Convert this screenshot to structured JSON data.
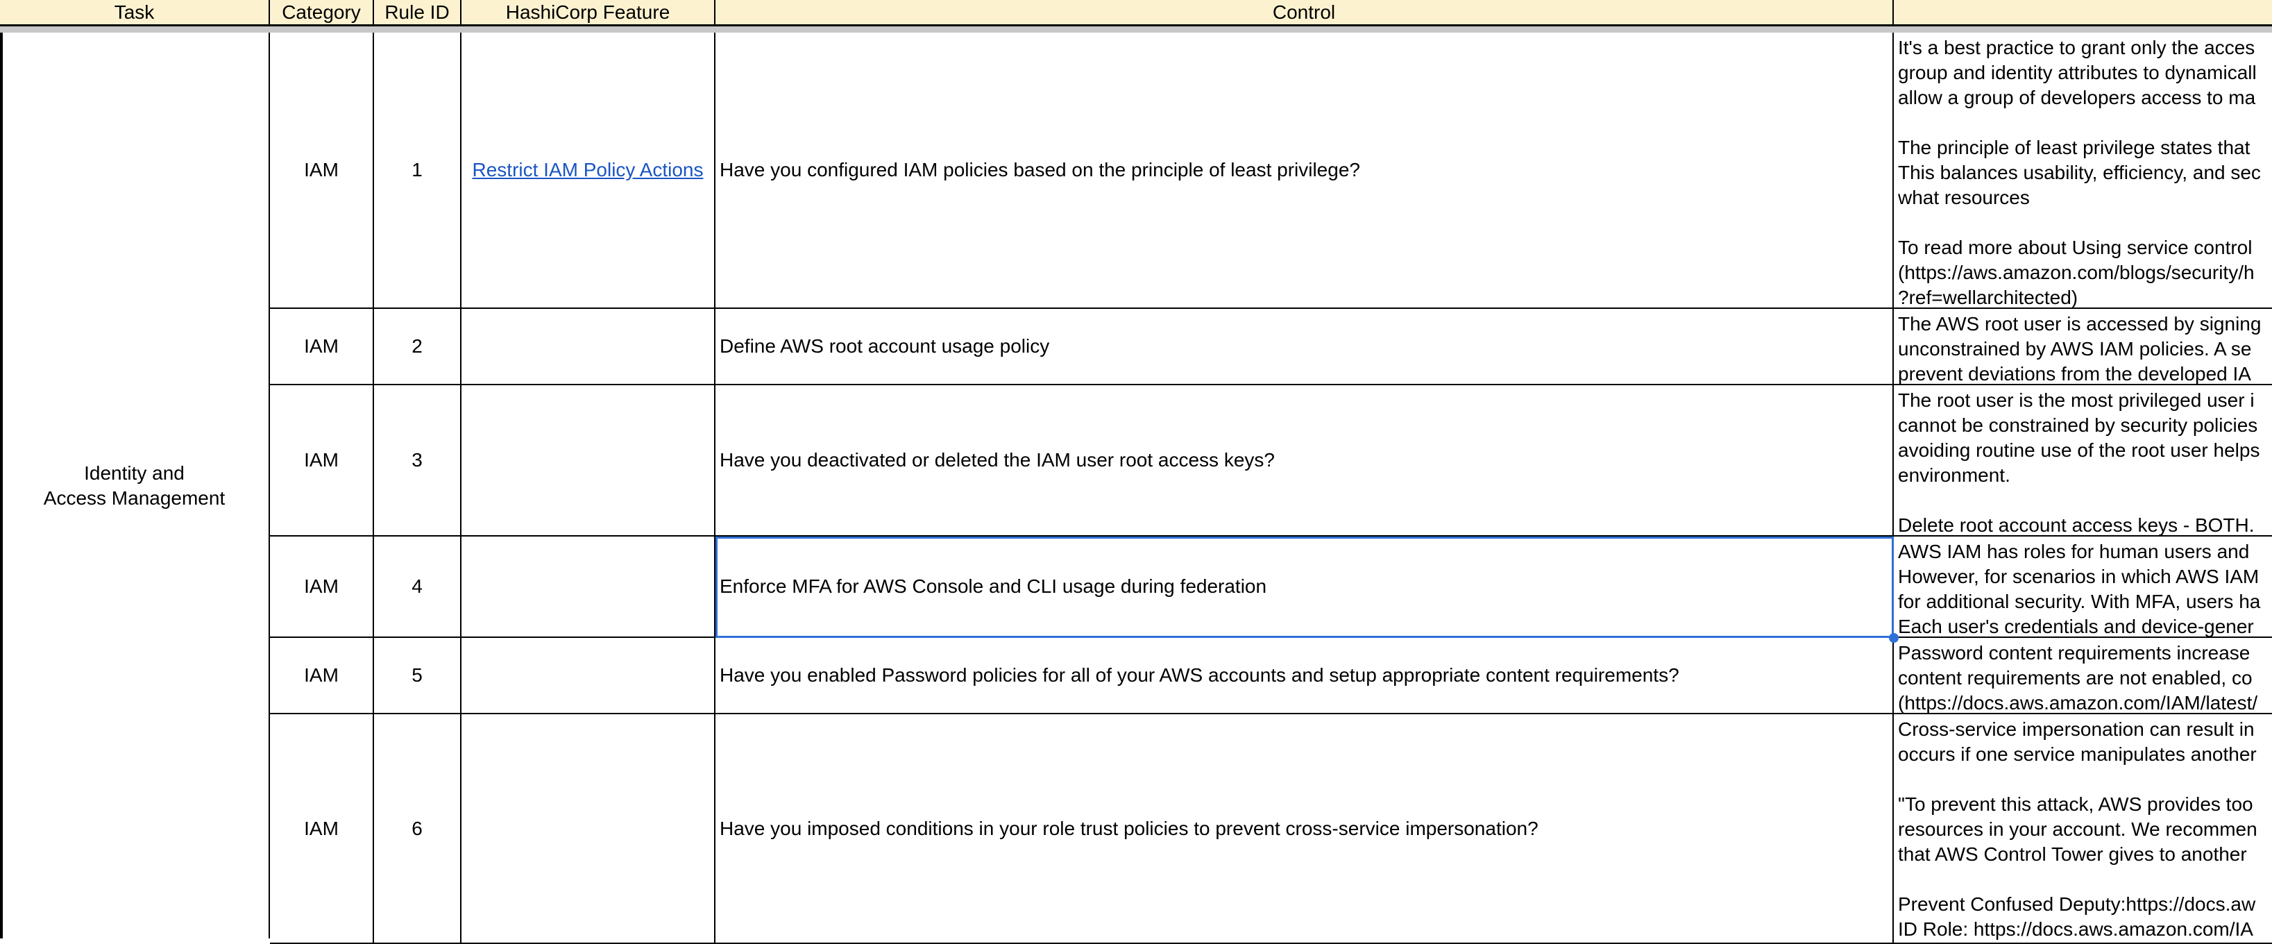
{
  "headers": {
    "task": "Task",
    "category": "Category",
    "rule_id": "Rule ID",
    "feature": "HashiCorp Feature",
    "control": "Control"
  },
  "task": "Identity and\nAccess Management",
  "rows": [
    {
      "category": "IAM",
      "rule_id": "1",
      "feature": "Restrict IAM Policy Actions",
      "control": "Have you configured IAM policies based on the principle of least privilege?",
      "description": "It's a best practice to grant only the acces\ngroup and identity attributes to dynamicall\nallow a group of developers access to ma\n\nThe principle of least privilege states that\nThis balances usability, efficiency, and sec\nwhat resources\n\nTo read more about Using service control\n(https://aws.amazon.com/blogs/security/h\n?ref=wellarchitected)"
    },
    {
      "category": "IAM",
      "rule_id": "2",
      "feature": "",
      "control": "Define AWS root account usage policy",
      "description": "The AWS root user is accessed by signing\nunconstrained by AWS IAM policies. A se\nprevent deviations from the developed IA"
    },
    {
      "category": "IAM",
      "rule_id": "3",
      "feature": "",
      "control": "Have you deactivated or deleted the IAM user root access keys?",
      "description": "The root user is the most privileged user i\ncannot be constrained by security policies\navoiding routine use of the root user helps\nenvironment.\n\nDelete root account access keys - BOTH."
    },
    {
      "category": "IAM",
      "rule_id": "4",
      "feature": "",
      "control": "Enforce MFA for AWS Console and CLI usage during federation",
      "description": "AWS IAM has roles for human users and\nHowever, for scenarios in which AWS IAM\nfor additional security. With MFA, users ha\nEach user's credentials and device-gener"
    },
    {
      "category": "IAM",
      "rule_id": "5",
      "feature": "",
      "control": "Have you enabled Password policies for all of your AWS accounts and setup appropriate content requirements?",
      "description": "Password content requirements increase\ncontent requirements are not enabled, co\n(https://docs.aws.amazon.com/IAM/latest/"
    },
    {
      "category": "IAM",
      "rule_id": "6",
      "feature": "",
      "control": "Have you imposed conditions in your role trust policies to prevent cross-service impersonation?",
      "description": "Cross-service impersonation can result in\noccurs if one service manipulates another\n\n\"To prevent this attack, AWS provides too\nresources in your account. We recommen\nthat AWS Control Tower gives to another\n\nPrevent Confused Deputy:https://docs.aw\nID Role: https://docs.aws.amazon.com/IA"
    }
  ]
}
